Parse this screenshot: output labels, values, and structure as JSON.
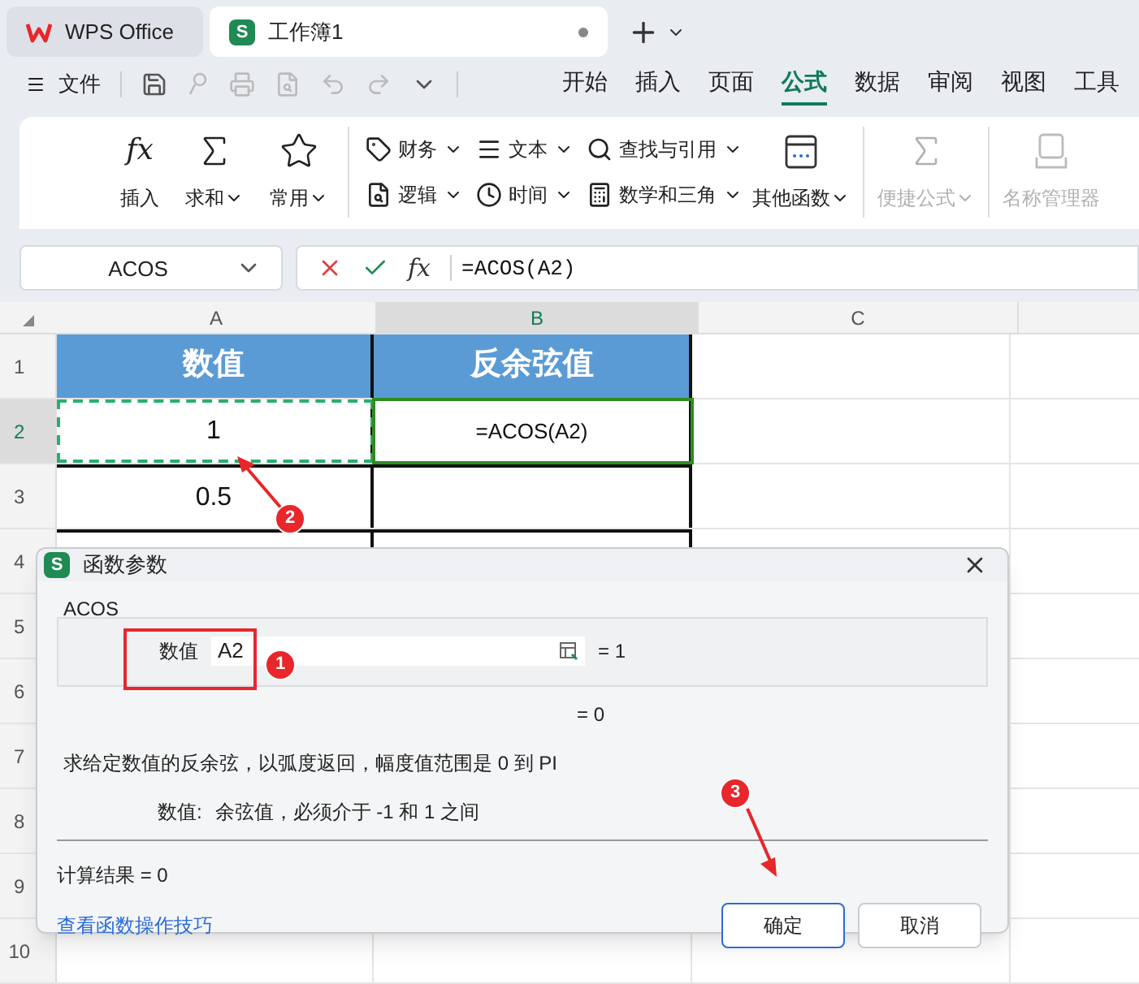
{
  "tabs": [
    {
      "kind": "home",
      "label": "WPS Office",
      "selected": false
    },
    {
      "kind": "document",
      "label": "工作簿1",
      "selected": true,
      "icon_text": "S"
    }
  ],
  "menu": {
    "file": "文件",
    "tabs": [
      {
        "label": "开始",
        "selected": false
      },
      {
        "label": "插入",
        "selected": false
      },
      {
        "label": "页面",
        "selected": false
      },
      {
        "label": "公式",
        "selected": true
      },
      {
        "label": "数据",
        "selected": false
      },
      {
        "label": "审阅",
        "selected": false
      },
      {
        "label": "视图",
        "selected": false
      },
      {
        "label": "工具",
        "selected": false
      }
    ]
  },
  "ribbon": [
    {
      "kind": "large",
      "label": "插入",
      "dropdown": false,
      "disabled": false,
      "icon_text": "fx"
    },
    {
      "kind": "large",
      "label": "求和",
      "dropdown": true,
      "disabled": false
    },
    {
      "kind": "large",
      "label": "常用",
      "dropdown": true,
      "disabled": false
    },
    {
      "kind": "small",
      "label": "财务",
      "dropdown": true,
      "disabled": false
    },
    {
      "kind": "small",
      "label": "逻辑",
      "dropdown": true,
      "disabled": false
    },
    {
      "kind": "small",
      "label": "文本",
      "dropdown": true,
      "disabled": false
    },
    {
      "kind": "small",
      "label": "时间",
      "dropdown": true,
      "disabled": false
    },
    {
      "kind": "small",
      "label": "查找与引用",
      "dropdown": true,
      "disabled": false
    },
    {
      "kind": "small",
      "label": "数学和三角",
      "dropdown": true,
      "disabled": false
    },
    {
      "kind": "large",
      "label": "其他函数",
      "dropdown": true,
      "disabled": false
    },
    {
      "kind": "large",
      "label": "便捷公式",
      "dropdown": true,
      "disabled": true
    },
    {
      "kind": "large",
      "label": "名称管理器",
      "dropdown": false,
      "disabled": true
    }
  ],
  "formula_bar": {
    "name_box": "ACOS",
    "function_button": "fx",
    "formula": "=ACOS(A2)"
  },
  "sheet": {
    "columns": [
      {
        "label": "A",
        "selected": false
      },
      {
        "label": "B",
        "selected": true
      },
      {
        "label": "C",
        "selected": false
      }
    ],
    "rows": [
      {
        "number": "1",
        "selected": false,
        "cells": [
          "数值",
          "反余弦值"
        ]
      },
      {
        "number": "2",
        "selected": true,
        "cells": [
          "1",
          "=ACOS(A2)"
        ]
      },
      {
        "number": "3",
        "selected": false,
        "cells": [
          "0.5"
        ]
      },
      {
        "number": "4",
        "selected": false,
        "cells": []
      },
      {
        "number": "5",
        "selected": false,
        "cells": []
      },
      {
        "number": "6",
        "selected": false,
        "cells": []
      },
      {
        "number": "7",
        "selected": false,
        "cells": []
      },
      {
        "number": "8",
        "selected": false,
        "cells": []
      },
      {
        "number": "9",
        "selected": false,
        "cells": []
      },
      {
        "number": "10",
        "selected": false,
        "cells": []
      }
    ]
  },
  "dialog": {
    "icon_text": "S",
    "title": "函数参数",
    "function": "ACOS",
    "argument_label": "数值",
    "argument_value": "A2",
    "argument_result": "= 1",
    "formula_result": "= 0",
    "description": "求给定数值的反余弦，以弧度返回，幅度值范围是 0 到 PI",
    "argument_help_label": "数值:",
    "argument_help": "余弦值，必须介于 -1 和 1 之间",
    "calc_result": "计算结果 = 0",
    "help_link": "查看函数操作技巧",
    "buttons": [
      {
        "label": "确定",
        "primary": true
      },
      {
        "label": "取消",
        "primary": false
      }
    ]
  },
  "annotations": [
    "1",
    "2",
    "3"
  ]
}
